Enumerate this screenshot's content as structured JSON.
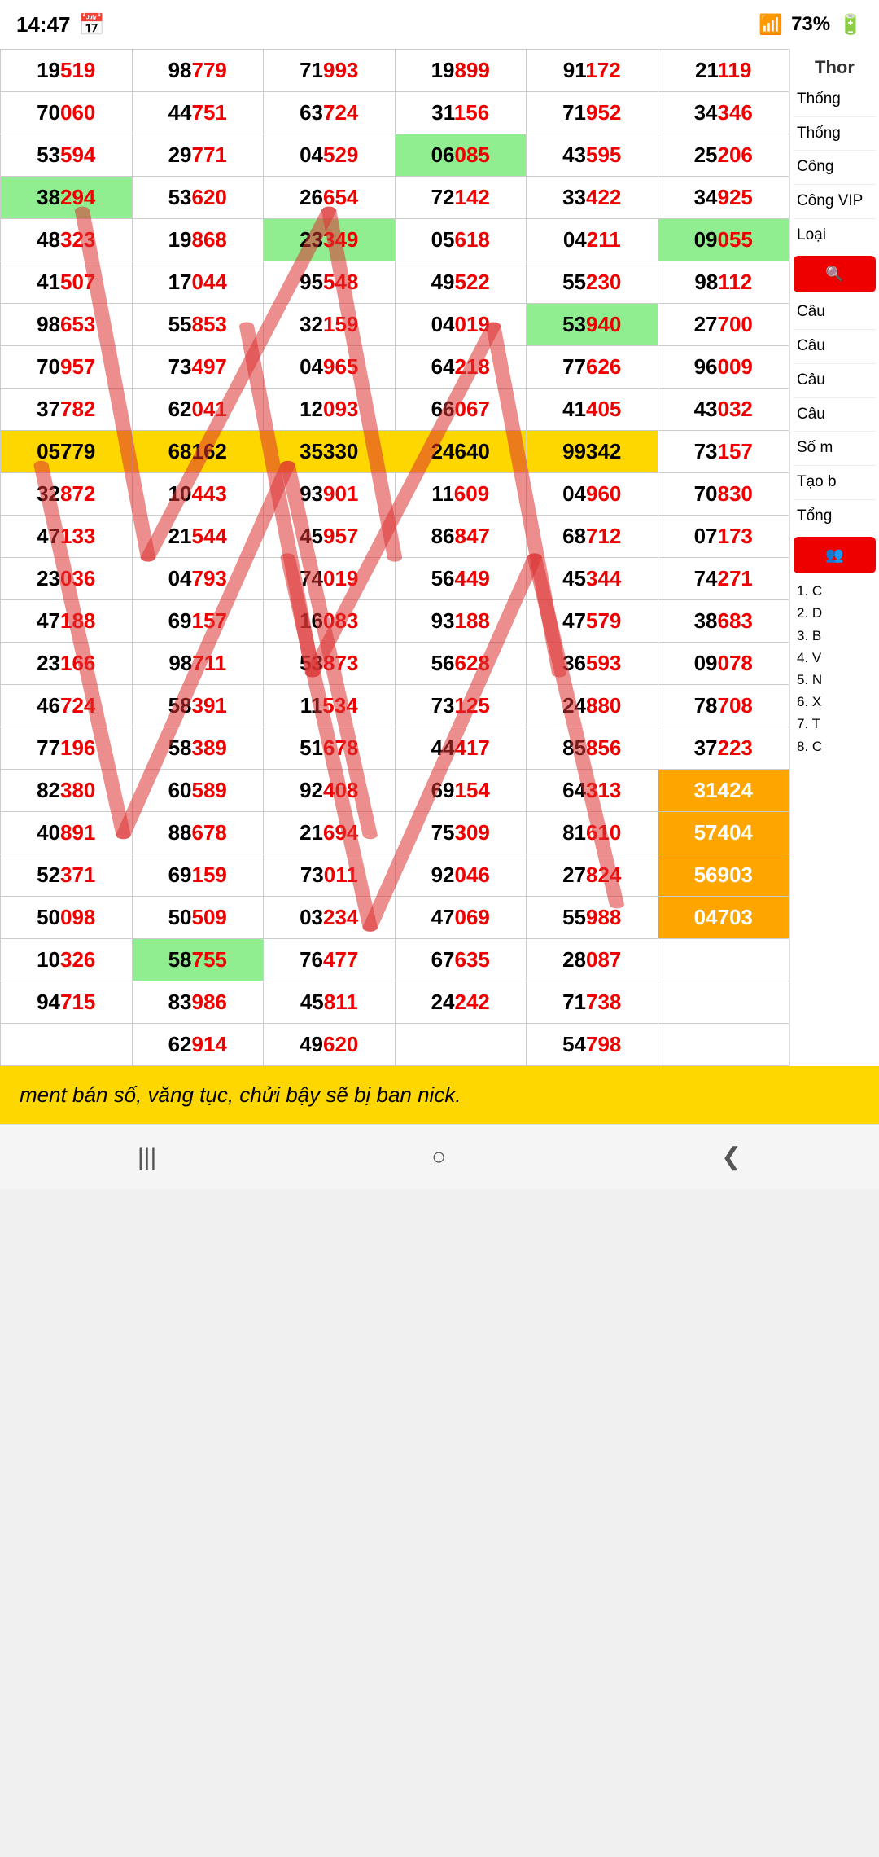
{
  "statusBar": {
    "time": "14:47",
    "calendarIcon": "calendar",
    "batteryIcon": "battery",
    "batteryPercent": "73%",
    "signalIcon": "signal"
  },
  "sidebar": {
    "items": [
      {
        "label": "Thống"
      },
      {
        "label": "Thống"
      },
      {
        "label": "Công"
      },
      {
        "label": "Công VIP"
      },
      {
        "label": "Loại"
      },
      {
        "label": "🔍",
        "isBtn": true
      },
      {
        "label": "Câu"
      },
      {
        "label": "Câu"
      },
      {
        "label": "Câu"
      },
      {
        "label": "Câu"
      },
      {
        "label": "Số m"
      },
      {
        "label": "Tạo b"
      },
      {
        "label": "Tổng"
      },
      {
        "label": "👥",
        "isBtn": true
      },
      {
        "label": "1. C\n2. D\n3. B\n4. V\n5. N\n6. X\n7. T\n8. C"
      }
    ],
    "thorLabel": "Thor"
  },
  "tableRows": [
    {
      "cols": [
        "19519",
        "98779",
        "71993",
        "19899",
        "91172",
        "21119"
      ],
      "highlights": []
    },
    {
      "cols": [
        "70060",
        "44751",
        "63724",
        "31156",
        "71952",
        "34346"
      ],
      "highlights": [
        {
          "col": 1,
          "class": "text-red"
        },
        {
          "col": 2,
          "class": "text-red"
        },
        {
          "col": 3,
          "class": "text-red"
        },
        {
          "col": 4,
          "class": "text-red"
        },
        {
          "col": 5,
          "class": "text-red"
        },
        {
          "col": 6,
          "class": "text-red"
        }
      ]
    },
    {
      "cols": [
        "53594",
        "29771",
        "04529",
        "06085",
        "43595",
        "25206"
      ],
      "highlights": [
        {
          "col": 4,
          "class": "highlight-green"
        },
        {
          "col": 5,
          "class": "text-red"
        }
      ]
    },
    {
      "cols": [
        "38294",
        "53620",
        "26654",
        "72142",
        "33422",
        "34925"
      ],
      "highlights": [
        {
          "col": 1,
          "class": "highlight-green"
        },
        {
          "col": 4,
          "class": "text-red"
        }
      ]
    },
    {
      "cols": [
        "48323",
        "19868",
        "23349",
        "05618",
        "04211",
        "09055"
      ],
      "highlights": [
        {
          "col": 3,
          "class": "highlight-green"
        },
        {
          "col": 6,
          "class": "highlight-green"
        }
      ]
    },
    {
      "cols": [
        "41507",
        "17044",
        "95548",
        "49522",
        "55230",
        "98112"
      ],
      "highlights": []
    },
    {
      "cols": [
        "98653",
        "55853",
        "32159",
        "04019",
        "53940",
        "27700"
      ],
      "highlights": [
        {
          "col": 5,
          "class": "highlight-green"
        },
        {
          "col": 6,
          "class": "text-red"
        }
      ]
    },
    {
      "cols": [
        "70957",
        "73497",
        "04965",
        "64218",
        "77626",
        "96009"
      ],
      "highlights": [
        {
          "col": 2,
          "class": "text-red"
        }
      ]
    },
    {
      "cols": [
        "37782",
        "62041",
        "12093",
        "66067",
        "41405",
        "43032"
      ],
      "highlights": [
        {
          "col": 5,
          "class": "text-red"
        }
      ]
    },
    {
      "cols": [
        "05779",
        "68162",
        "35330",
        "24640",
        "99342",
        "73157"
      ],
      "highlights": [
        {
          "col": 1,
          "class": "highlight-yellow"
        },
        {
          "col": 2,
          "class": "highlight-yellow"
        },
        {
          "col": 3,
          "class": "highlight-yellow"
        },
        {
          "col": 4,
          "class": "highlight-yellow"
        },
        {
          "col": 5,
          "class": "highlight-yellow"
        }
      ]
    },
    {
      "cols": [
        "32872",
        "10443",
        "93901",
        "11609",
        "04960",
        "70830"
      ],
      "highlights": [
        {
          "col": 3,
          "class": "text-red"
        },
        {
          "col": 4,
          "class": "text-red"
        },
        {
          "col": 5,
          "class": "text-red"
        }
      ]
    },
    {
      "cols": [
        "47133",
        "21544",
        "45957",
        "86847",
        "68712",
        "07173"
      ],
      "highlights": [
        {
          "col": 1,
          "class": "text-red"
        }
      ]
    },
    {
      "cols": [
        "23036",
        "04793",
        "74019",
        "56449",
        "45344",
        "74271"
      ],
      "highlights": []
    },
    {
      "cols": [
        "47188",
        "69157",
        "16083",
        "93188",
        "47579",
        "38683"
      ],
      "highlights": []
    },
    {
      "cols": [
        "23166",
        "98711",
        "53873",
        "56628",
        "36593",
        "09078"
      ],
      "highlights": [
        {
          "col": 2,
          "class": "text-red"
        }
      ]
    },
    {
      "cols": [
        "46724",
        "58391",
        "11534",
        "73125",
        "24880",
        "78708"
      ],
      "highlights": []
    },
    {
      "cols": [
        "77196",
        "58389",
        "51678",
        "44417",
        "85856",
        "37223"
      ],
      "highlights": [
        {
          "col": 5,
          "class": "text-red"
        }
      ]
    },
    {
      "cols": [
        "82380",
        "60589",
        "92408",
        "69154",
        "64313",
        "31424"
      ],
      "highlights": [
        {
          "col": 6,
          "class": "highlight-orange"
        }
      ]
    },
    {
      "cols": [
        "40891",
        "88678",
        "21694",
        "75309",
        "81610",
        "57404"
      ],
      "highlights": [
        {
          "col": 6,
          "class": "highlight-orange"
        }
      ]
    },
    {
      "cols": [
        "52371",
        "69159",
        "73011",
        "92046",
        "27824",
        "56903"
      ],
      "highlights": [
        {
          "col": 5,
          "class": "text-red"
        },
        {
          "col": 6,
          "class": "highlight-orange"
        }
      ]
    },
    {
      "cols": [
        "50098",
        "50509",
        "03234",
        "47069",
        "55988",
        "04703"
      ],
      "highlights": [
        {
          "col": 5,
          "class": "text-red"
        },
        {
          "col": 6,
          "class": "highlight-orange"
        }
      ]
    },
    {
      "cols": [
        "10326",
        "58755",
        "76477",
        "67635",
        "28087",
        ""
      ],
      "highlights": [
        {
          "col": 2,
          "class": "highlight-green"
        },
        {
          "col": 5,
          "class": "text-red"
        }
      ]
    },
    {
      "cols": [
        "94715",
        "83986",
        "45811",
        "24242",
        "71738",
        ""
      ],
      "highlights": []
    },
    {
      "cols": [
        "",
        "62914",
        "49620",
        "",
        "54798",
        ""
      ],
      "highlights": []
    }
  ],
  "warningText": "ment bán số, văng tục, chửi bậy sẽ bị ban nick.",
  "nav": {
    "backBtn": "❮",
    "homeBtn": "○",
    "menuBtn": "|||"
  }
}
